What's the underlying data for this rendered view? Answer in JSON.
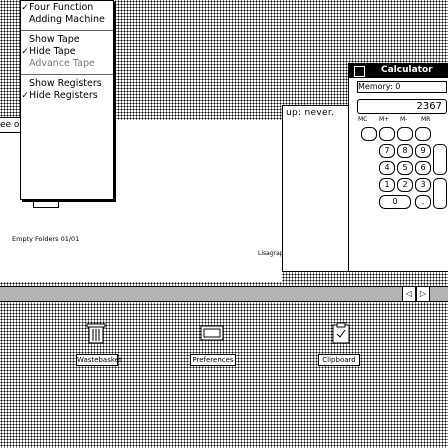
{
  "menu": {
    "items": [
      {
        "label": "Four Function",
        "checked": true
      },
      {
        "label": "Adding Machine",
        "checked": false
      },
      {
        "label": "Show Tape",
        "checked": false
      },
      {
        "label": "Hide Tape",
        "checked": true
      },
      {
        "label": "Advance Tape",
        "checked": false,
        "disabled": true
      },
      {
        "label": "Show Registers",
        "checked": false
      },
      {
        "label": "Hide Registers",
        "checked": true
      }
    ],
    "check_glyph": "✓"
  },
  "calculator": {
    "title": "Calculator",
    "memory_label": "Memory: 0",
    "display": "2367",
    "memory_keys": [
      "MC",
      "M+",
      "M-",
      "MR"
    ],
    "keys": [
      "7",
      "8",
      "9",
      "4",
      "5",
      "6",
      "1",
      "2",
      "3",
      "0",
      "."
    ]
  },
  "register_window": {
    "text": "up: never."
  },
  "left_window": {
    "out_text": "ee out",
    "folder_caption": "Empty Folders 01/01"
  },
  "mid_panel": {
    "caption": "Lisagraph"
  },
  "desktop": {
    "icons": [
      {
        "label": "Wastebasket",
        "icon": "wastebasket-icon"
      },
      {
        "label": "Preferences",
        "icon": "preferences-icon"
      },
      {
        "label": "Clipboard",
        "icon": "clipboard-icon"
      }
    ]
  }
}
